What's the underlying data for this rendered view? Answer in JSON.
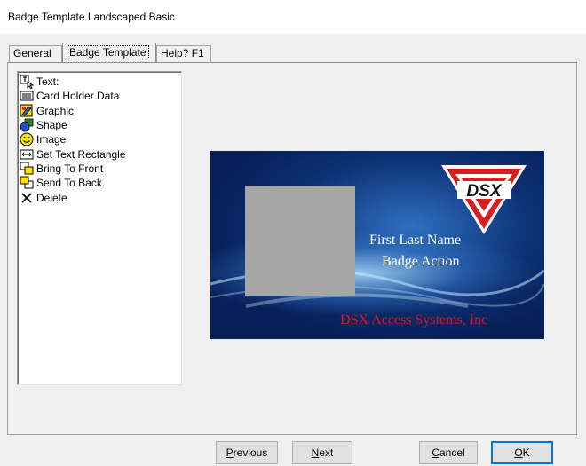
{
  "window": {
    "title": "Badge Template Landscaped Basic"
  },
  "tabs": [
    {
      "label": "General"
    },
    {
      "label": "Badge Template"
    },
    {
      "label": "Help?  F1"
    }
  ],
  "tools": [
    {
      "label": "Text:",
      "icon": "text-cursor-icon"
    },
    {
      "label": "Card Holder Data",
      "icon": "card-icon"
    },
    {
      "label": "Graphic",
      "icon": "graphic-icon"
    },
    {
      "label": "Shape",
      "icon": "shape-icon"
    },
    {
      "label": "Image",
      "icon": "smiley-icon"
    },
    {
      "label": "Set Text Rectangle",
      "icon": "resize-icon"
    },
    {
      "label": "Bring To Front",
      "icon": "bring-front-icon"
    },
    {
      "label": "Send To Back",
      "icon": "send-back-icon"
    },
    {
      "label": "Delete",
      "icon": "delete-x-icon"
    }
  ],
  "badge": {
    "name_text": "First Last Name",
    "action_text": "Badge Action",
    "company_text": "DSX Access Systems, Inc",
    "logo_text": "DSX",
    "company_color": "#d01c1c"
  },
  "buttons": {
    "previous": {
      "first": "P",
      "rest": "revious"
    },
    "next": {
      "first": "N",
      "rest": "ext"
    },
    "cancel": {
      "first": "C",
      "rest": "ancel"
    },
    "ok": {
      "first": "O",
      "rest": "K"
    }
  }
}
